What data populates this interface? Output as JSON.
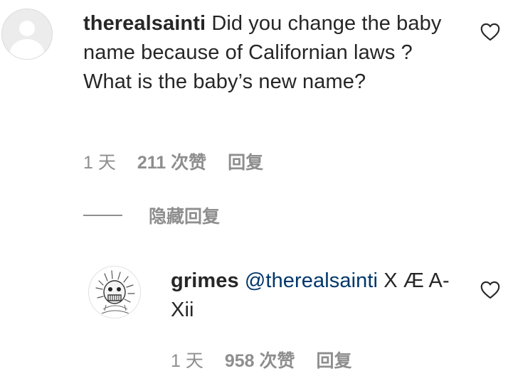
{
  "comment": {
    "username": "therealsainti",
    "text": "Did you change the baby name because of Californian laws ? What is the baby’s new name?",
    "time": "1 天",
    "likes": "211 次赞",
    "reply_label": "回复"
  },
  "hide_replies_label": "隐藏回复",
  "reply": {
    "username": "grimes",
    "mention": "@therealsainti",
    "text": "X Æ A-Xii",
    "time": "1 天",
    "likes": "958 次赞",
    "reply_label": "回复"
  },
  "icons": {
    "like": "heart-outline-icon",
    "avatar_placeholder": "default-avatar-icon"
  },
  "colors": {
    "text": "#262626",
    "secondary": "#8e8e8e",
    "mention": "#00376b"
  }
}
